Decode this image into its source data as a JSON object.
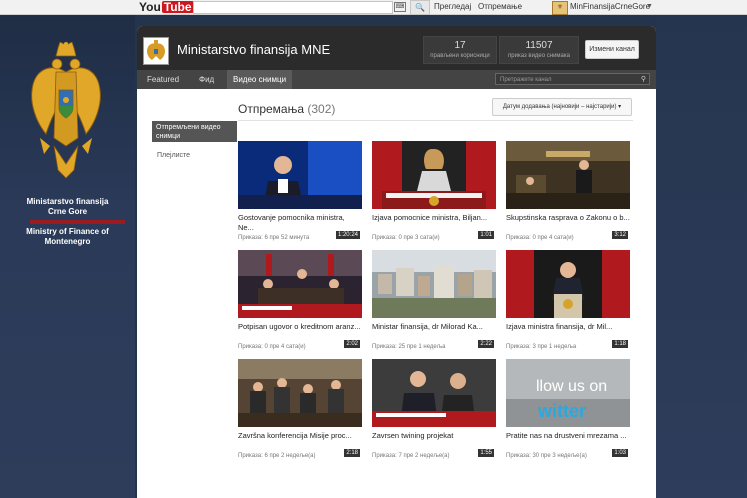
{
  "topbar": {
    "logo_you": "You",
    "logo_tube": "Tube",
    "search_placeholder": "",
    "keyboard_icon": "keyboard-icon",
    "search_button_icon": "search-icon",
    "link_browse": "Прегледај",
    "link_upload": "Отпремање",
    "username": "MinFinansijaCrneGore"
  },
  "background": {
    "caption_me_1": "Ministarstvo finansija",
    "caption_me_2": "Crne Gore",
    "caption_en_1": "Ministry of Finance of",
    "caption_en_2": "Montenegro"
  },
  "channel": {
    "title": "Ministarstvo finansija MNE",
    "subscribers_count": "17",
    "subscribers_label": "прављени корисници",
    "views_count": "11507",
    "views_label": "приказ видео снимака",
    "edit_button": "Измени канал",
    "tabs": [
      "Featured",
      "Фид",
      "Видео снимци"
    ],
    "search_placeholder": "Претражите канал"
  },
  "sidebar": {
    "active_item": "Отпремљени видео снимци",
    "playlists": "Плејлисте"
  },
  "uploads": {
    "title": "Отпремања",
    "count": "(302)",
    "sort_label": "Датум додавања (најновији – најстарији) ▾"
  },
  "videos": [
    {
      "title": "Gostovanje pomocnika ministra, Ne...",
      "meta": "Приказа: 6 пре 52 минута",
      "duration": "1:20:24",
      "thumb": "studio"
    },
    {
      "title": "Izjava pomocnice ministra, Biljan...",
      "meta": "Приказа: 0 пре 3 сата(и)",
      "duration": "1:01",
      "thumb": "press"
    },
    {
      "title": "Skupstinska rasprava o Zakonu o b...",
      "meta": "Приказа: 0 пре 4 сата(и)",
      "duration": "3:12",
      "thumb": "parliament"
    },
    {
      "title": "Potpisan ugovor o kreditnom aranz...",
      "meta": "Приказа: 0 пре 4 сата(и)",
      "duration": "2:02",
      "thumb": "signing"
    },
    {
      "title": "Ministar finansija, dr Milorad Ka...",
      "meta": "Приказа: 25 пре 1 недеља",
      "duration": "2:22",
      "thumb": "city"
    },
    {
      "title": "Izjava ministra finansija, dr Mil...",
      "meta": "Приказа: 3 пре 1 недеља",
      "duration": "1:18",
      "thumb": "podium"
    },
    {
      "title": "Završna konferencija Misije proc...",
      "meta": "Приказа: 6 пре 2 недеље(а)",
      "duration": "2:18",
      "thumb": "conference"
    },
    {
      "title": "Zavrsen twining projekat",
      "meta": "Приказа: 7 пре 2 недеље(а)",
      "duration": "1:55",
      "thumb": "twoman"
    },
    {
      "title": "Pratite nas na drustveni mrezama ...",
      "meta": "Приказа: 30 пре 3 недеље(а)",
      "duration": "1:03",
      "thumb": "twitter"
    }
  ]
}
